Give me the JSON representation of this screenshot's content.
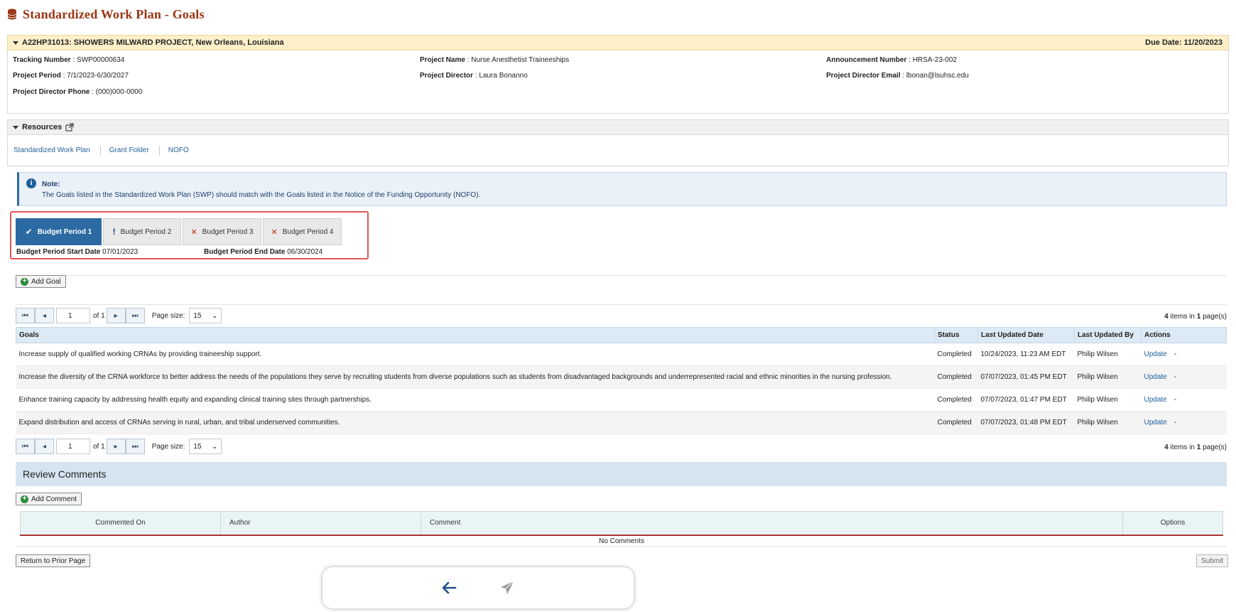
{
  "page": {
    "title": "Standardized Work Plan - Goals"
  },
  "project": {
    "header": "A22HP31013: SHOWERS MILWARD PROJECT, New Orleans, Louisiana",
    "due_date": "Due Date: 11/20/2023",
    "fields": {
      "tracking_label": "Tracking Number",
      "tracking_value": "SWP00000634",
      "period_label": "Project Period",
      "period_value": "7/1/2023-6/30/2027",
      "phone_label": "Project Director Phone",
      "phone_value": "(000)000-0000",
      "name_label": "Project Name",
      "name_value": "Nurse Anesthetist Traineeships",
      "director_label": "Project Director",
      "director_value": "Laura Bonanno",
      "announcement_label": "Announcement Number",
      "announcement_value": "HRSA-23-002",
      "email_label": "Project Director Email",
      "email_value": "lbonan@lsuhsc.edu"
    }
  },
  "resources": {
    "title": "Resources",
    "links": [
      "Standardized Work Plan",
      "Grant Folder",
      "NOFO"
    ]
  },
  "note": {
    "title": "Note:",
    "text": "The Goals listed in the Standardized Work Plan (SWP) should match with the Goals listed in the Notice of the Funding Opportunity (NOFO)."
  },
  "budget_periods": {
    "tabs": [
      {
        "label": "Budget Period 1",
        "mark": "✔"
      },
      {
        "label": "Budget Period 2",
        "mark": "!"
      },
      {
        "label": "Budget Period 3",
        "mark": "✕"
      },
      {
        "label": "Budget Period 4",
        "mark": "✕"
      }
    ],
    "start_label": "Budget Period Start Date",
    "start_value": "07/01/2023",
    "end_label": "Budget Period End Date",
    "end_value": "06/30/2024"
  },
  "actions": {
    "add_goal": "Add Goal",
    "add_comment": "Add Comment",
    "return": "Return to Prior Page",
    "submit": "Submit"
  },
  "pager": {
    "page": "1",
    "of": "of 1",
    "page_size_label": "Page size:",
    "page_size": "15",
    "items_count": "4",
    "items_mid": " items in ",
    "pages_count": "1",
    "items_end": " page(s)"
  },
  "goals_table": {
    "headers": [
      "Goals",
      "Status",
      "Last Updated Date",
      "Last Updated By",
      "Actions"
    ],
    "rows": [
      {
        "goal": "Increase supply of qualified working CRNAs by providing traineeship support.",
        "status": "Completed",
        "date": "10/24/2023, 11:23 AM EDT",
        "by": "Philip Wilsen",
        "action": "Update",
        "dash": "-"
      },
      {
        "goal": "Increase the diversity of the CRNA workforce to better address the needs of the populations they serve by recruiting students from diverse populations such as students from disadvantaged backgrounds and underrepresented racial and ethnic minorities in the nursing profession.",
        "status": "Completed",
        "date": "07/07/2023, 01:45 PM EDT",
        "by": "Philip Wilsen",
        "action": "Update",
        "dash": "-"
      },
      {
        "goal": "Enhance training capacity by addressing health equity and expanding clinical training sites through partnerships.",
        "status": "Completed",
        "date": "07/07/2023, 01:47 PM EDT",
        "by": "Philip Wilsen",
        "action": "Update",
        "dash": "-"
      },
      {
        "goal": "Expand distribution and access of CRNAs serving in rural, urban, and tribal underserved communities.",
        "status": "Completed",
        "date": "07/07/2023, 01:48 PM EDT",
        "by": "Philip Wilsen",
        "action": "Update",
        "dash": "-"
      }
    ]
  },
  "review": {
    "title": "Review Comments",
    "headers": [
      "Commented On",
      "Author",
      "Comment",
      "Options"
    ],
    "empty": "No Comments"
  },
  "icons": {
    "accent": "#2b6aa3",
    "title_color": "#9a3412"
  }
}
